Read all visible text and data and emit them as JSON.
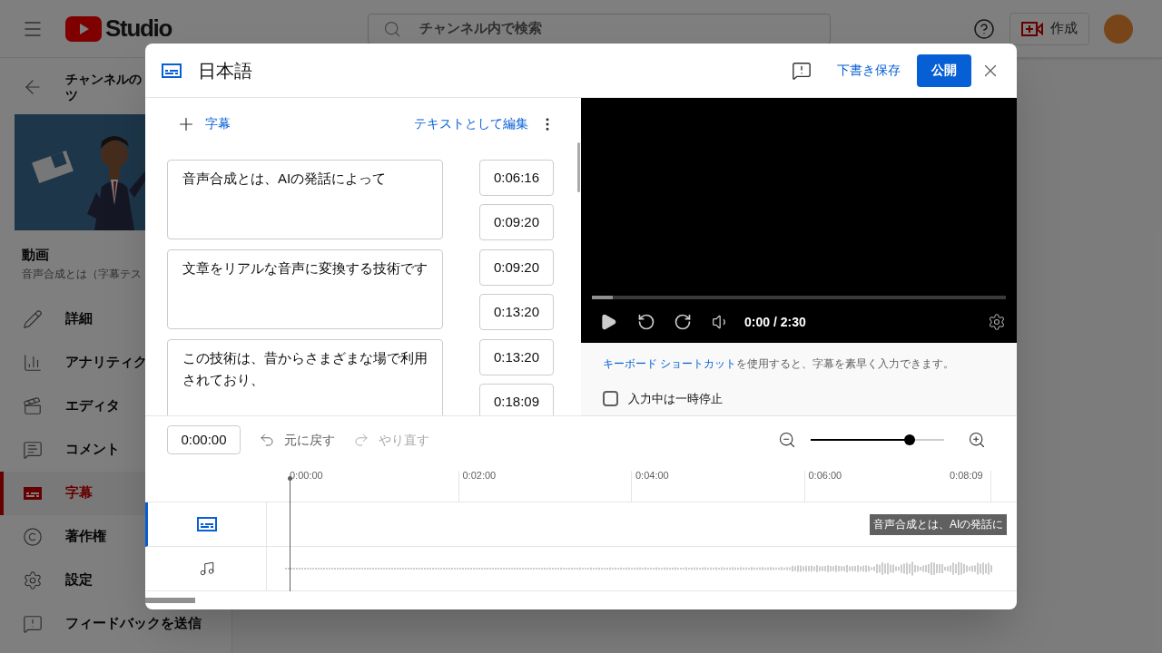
{
  "app": {
    "logo_text": "Studio",
    "search": {
      "placeholder": "チャンネル内で検索"
    },
    "create_button": "作成"
  },
  "sidebar": {
    "title_lines": [
      "チャンネルの",
      "ツ"
    ],
    "video_label": "動画",
    "video_title": "音声合成とは（字幕テス",
    "items": [
      {
        "kind": "pencil",
        "label": "詳細",
        "selected": false
      },
      {
        "kind": "chart",
        "label": "アナリティク",
        "selected": false
      },
      {
        "kind": "clapper",
        "label": "エディタ",
        "selected": false
      },
      {
        "kind": "comment",
        "label": "コメント",
        "selected": false
      },
      {
        "kind": "captions",
        "label": "字幕",
        "selected": true
      },
      {
        "kind": "copyright",
        "label": "著作権",
        "selected": false
      },
      {
        "kind": "gear",
        "label": "設定",
        "selected": false
      },
      {
        "kind": "feedback",
        "label": "フィードバックを送信",
        "selected": false
      }
    ]
  },
  "dialog": {
    "title": "日本語",
    "save_draft": "下書き保存",
    "publish": "公開",
    "add_caption": "字幕",
    "edit_as_text": "テキストとして編集",
    "cues": [
      {
        "text": "音声合成とは、AIの発話によって",
        "start": "0:06:16",
        "end": "0:09:20"
      },
      {
        "text": "文章をリアルな音声に変換する技術です",
        "start": "0:09:20",
        "end": "0:13:20"
      },
      {
        "text": "この技術は、昔からさまざまな場で利用されており、",
        "start": "0:13:20",
        "end": "0:18:09"
      }
    ],
    "player": {
      "time": "0:00 / 2:30",
      "level": 0.05
    },
    "shortcut_link": "キーボード ショートカット",
    "shortcut_text": "を使用すると、字幕を素早く入力できます。",
    "pause_while_typing": {
      "label": "入力中は一時停止",
      "checked": false
    },
    "timeline": {
      "current_time": "0:00:00",
      "undo": {
        "label": "元に戻す",
        "disabled": false
      },
      "redo": {
        "label": "やり直す",
        "disabled": true
      },
      "zoom": {
        "level": 0.74
      },
      "ticks": [
        "0:00:00",
        "0:02:00",
        "0:04:00",
        "0:06:00",
        "0:08:09"
      ],
      "cue_label": "音声合成とは、AIの発話に",
      "tracks": [
        {
          "kind": "captions",
          "selected": true
        },
        {
          "kind": "audio",
          "selected": false
        }
      ]
    }
  }
}
